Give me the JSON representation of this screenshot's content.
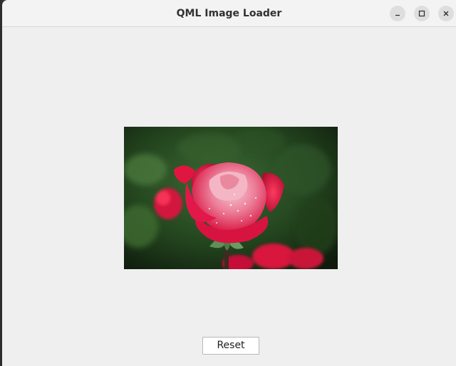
{
  "window": {
    "title": "QML Image Loader"
  },
  "titlebar_buttons": {
    "minimize_icon": "minimize-icon",
    "maximize_icon": "maximize-icon",
    "close_icon": "close-icon"
  },
  "content": {
    "image": {
      "subject_icon": "rose-photo"
    },
    "reset_label": "Reset"
  },
  "colors": {
    "window_bg": "#efefef",
    "titlebar_bg": "#f3f3f3",
    "rose_red": "#e0163f",
    "foliage_green": "#2f5a2a"
  }
}
